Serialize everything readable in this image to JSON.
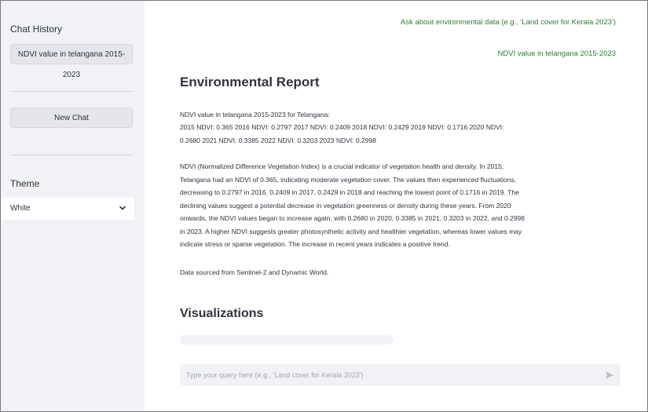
{
  "sidebar": {
    "chat_history_heading": "Chat History",
    "history_items": [
      {
        "label": "NDVI value in telangana 2015-2023"
      }
    ],
    "new_chat_label": "New Chat",
    "theme_heading": "Theme",
    "theme_selected": "White"
  },
  "main": {
    "messages": [
      {
        "text": "Ask about environmental data (e.g., 'Land cover for Kerala 2023')"
      },
      {
        "text": "NDVI value in telangana 2015-2023"
      }
    ],
    "report_title": "Environmental Report",
    "report_paragraphs": [
      "NDVI value in telangana 2015-2023 for Telangana:",
      "2015 NDVI: 0.365 2016 NDVI: 0.2797 2017 NDVI: 0.2409 2018 NDVI: 0.2429 2019 NDVI: 0.1716 2020 NDVI: 0.2680 2021 NDVI: 0.3385 2022 NDVI: 0.3203 2023 NDVI: 0.2998",
      "NDVI (Normalized Difference Vegetation Index) is a crucial indicator of vegetation health and density. In 2015, Telangana had an NDVI of 0.365, indicating moderate vegetation cover. The values then experienced fluctuations, decreasing to 0.2797 in 2016, 0.2409 in 2017, 0.2429 in 2018 and reaching the lowest point of 0.1716 in 2019. The declining values suggest a potential decrease in vegetation greenness or density during these years. From 2020 onwards, the NDVI values began to increase again, with 0.2680 in 2020, 0.3385 in 2021, 0.3203 in 2022, and 0.2998 in 2023. A higher NDVI suggests greater photosynthetic activity and healthier vegetation, whereas lower values may indicate stress or sparse vegetation. The increase in recent years indicates a positive trend.",
      "Data sourced from Sentinel-2 and Dynamic World."
    ],
    "visualizations_title": "Visualizations",
    "chat_input": {
      "value": "",
      "placeholder": "Type your query here (e.g., 'Land cover for Kerala 2023')"
    }
  },
  "icons": {
    "theme_dropdown": "chevron-down-icon",
    "send": "send-icon"
  },
  "colors": {
    "sidebar_bg": "#f0f2f6",
    "user_message_text": "#2e7d32",
    "text": "#31333f"
  }
}
